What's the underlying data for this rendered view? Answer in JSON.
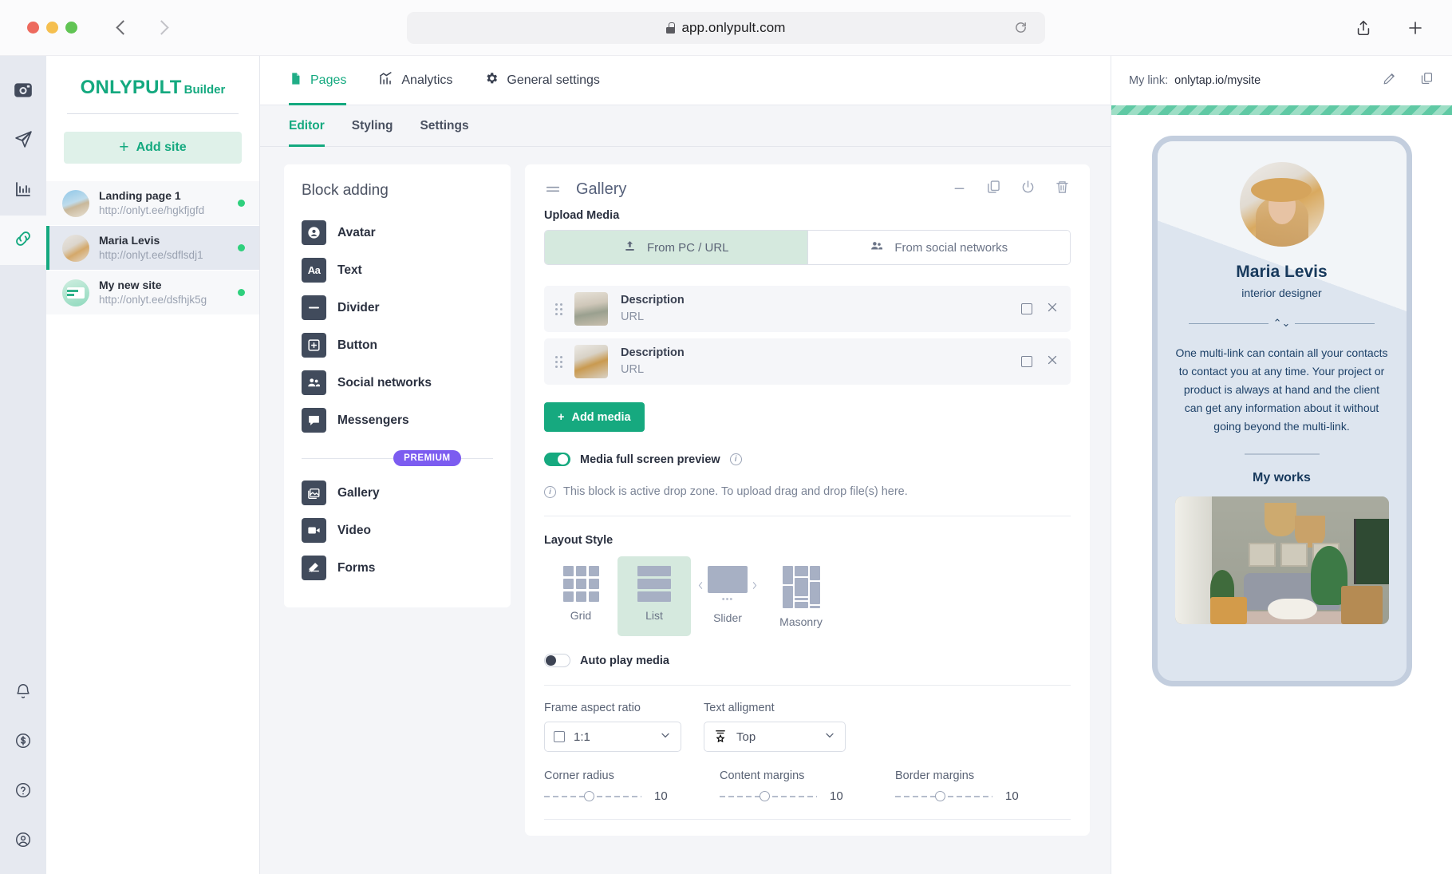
{
  "browser": {
    "url": "app.onlypult.com",
    "icons": {
      "back": "chevron-left-icon",
      "forward": "chevron-right-icon",
      "reload": "reload-icon",
      "share": "share-icon",
      "newtab": "plus-icon",
      "lock": "lock-icon"
    }
  },
  "rail": {
    "items": [
      {
        "name": "instagram-icon",
        "active": false
      },
      {
        "name": "send-icon",
        "active": false
      },
      {
        "name": "analytics-icon",
        "active": false
      },
      {
        "name": "link-icon",
        "active": true
      }
    ],
    "bottom": [
      {
        "name": "bell-icon"
      },
      {
        "name": "dollar-icon"
      },
      {
        "name": "help-icon"
      },
      {
        "name": "account-icon"
      }
    ]
  },
  "sidebar": {
    "brand": "ONLYPULT",
    "brand_sub": "Builder",
    "add_site_label": "Add site",
    "sites": [
      {
        "title": "Landing page 1",
        "url": "http://onlyt.ee/hgkfjgfd",
        "selected": false
      },
      {
        "title": "Maria Levis",
        "url": "http://onlyt.ee/sdflsdj1",
        "selected": true
      },
      {
        "title": "My new site",
        "url": "http://onlyt.ee/dsfhjk5g",
        "selected": false
      }
    ]
  },
  "topnav": {
    "items": [
      {
        "label": "Pages",
        "icon": "page-icon",
        "active": true
      },
      {
        "label": "Analytics",
        "icon": "chart-icon",
        "active": false
      },
      {
        "label": "General settings",
        "icon": "gear-icon",
        "active": false
      }
    ]
  },
  "subtabs": [
    {
      "label": "Editor",
      "active": true
    },
    {
      "label": "Styling",
      "active": false
    },
    {
      "label": "Settings",
      "active": false
    }
  ],
  "block_adding": {
    "title": "Block adding",
    "free_items": [
      {
        "label": "Avatar",
        "icon": "avatar-icon"
      },
      {
        "label": "Text",
        "icon": "text-icon"
      },
      {
        "label": "Divider",
        "icon": "divider-icon"
      },
      {
        "label": "Button",
        "icon": "button-icon"
      },
      {
        "label": "Social networks",
        "icon": "social-networks-icon"
      },
      {
        "label": "Messengers",
        "icon": "messengers-icon"
      }
    ],
    "premium_badge": "PREMIUM",
    "premium_items": [
      {
        "label": "Gallery",
        "icon": "gallery-icon"
      },
      {
        "label": "Video",
        "icon": "video-icon"
      },
      {
        "label": "Forms",
        "icon": "forms-icon"
      }
    ]
  },
  "gallery": {
    "title": "Gallery",
    "header_actions": [
      "minimize-icon",
      "duplicate-icon",
      "power-icon",
      "trash-icon"
    ],
    "upload_label": "Upload Media",
    "upload_tabs": [
      {
        "label": "From PC / URL",
        "icon": "upload-icon",
        "active": true
      },
      {
        "label": "From social networks",
        "icon": "people-icon",
        "active": false
      }
    ],
    "media_items": [
      {
        "description": "Description",
        "url": "URL"
      },
      {
        "description": "Description",
        "url": "URL"
      }
    ],
    "add_media_label": "Add media",
    "fullscreen_toggle": {
      "label": "Media full screen preview",
      "on": true
    },
    "dropzone_text": "This block is active drop zone. To upload drag and drop file(s) here.",
    "layout_label": "Layout Style",
    "layouts": [
      {
        "label": "Grid",
        "active": false
      },
      {
        "label": "List",
        "active": true
      },
      {
        "label": "Slider",
        "active": false
      },
      {
        "label": "Masonry",
        "active": false
      }
    ],
    "autoplay_toggle": {
      "label": "Auto play media",
      "on": false
    },
    "frame_aspect": {
      "label": "Frame aspect ratio",
      "value": "1:1"
    },
    "text_alignment": {
      "label": "Text alligment",
      "value": "Top"
    },
    "sliders": [
      {
        "label": "Corner radius",
        "value": "10"
      },
      {
        "label": "Content margins",
        "value": "10"
      },
      {
        "label": "Border margins",
        "value": "10"
      }
    ]
  },
  "preview": {
    "link_label": "My link:",
    "link_value": "onlytap.io/mysite",
    "actions": [
      "edit-icon",
      "copy-icon"
    ],
    "phone": {
      "name": "Maria Levis",
      "role": "interior designer",
      "bio": "One multi-link can contain all your contacts to contact you at any time. Your project or product is always at hand and the client can get any information about it without going beyond the multi-link.",
      "works_title": "My works"
    }
  },
  "colors": {
    "accent": "#14a97f",
    "premium": "#7c5cf0",
    "dark_icon": "#414b5c",
    "preview_text": "#17395c"
  }
}
